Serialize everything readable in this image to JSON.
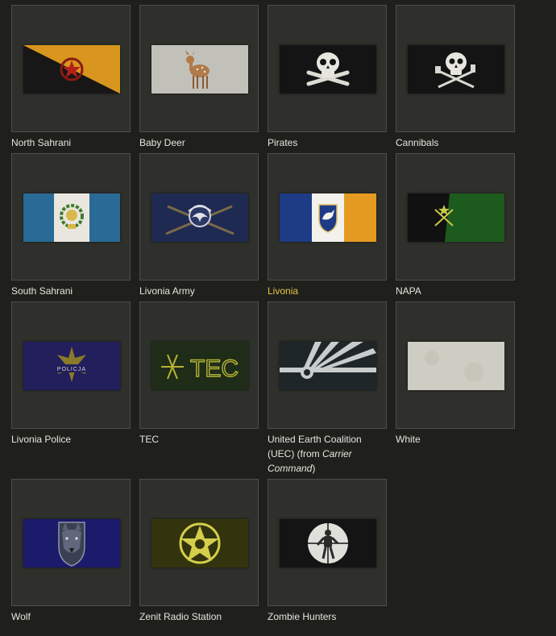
{
  "accent_color": "#e8c545",
  "flags": [
    {
      "name": "North Sahrani",
      "icon": "star-emblem-icon"
    },
    {
      "name": "Baby Deer",
      "icon": "deer-icon"
    },
    {
      "name": "Pirates",
      "icon": "skull-crossbones-icon"
    },
    {
      "name": "Cannibals",
      "icon": "skull-utensils-icon"
    },
    {
      "name": "South Sahrani",
      "icon": "wreath-emblem-icon"
    },
    {
      "name": "Livonia Army",
      "icon": "army-emblem-icon"
    },
    {
      "name": "Livonia",
      "icon": "shield-emblem-icon",
      "selected": true
    },
    {
      "name": "NAPA",
      "icon": "star-rifles-icon"
    },
    {
      "name": "Livonia Police",
      "icon": "police-badge-icon"
    },
    {
      "name": "TEC",
      "icon": "tec-logo-icon",
      "text": "TEC"
    },
    {
      "name_parts": [
        "United Earth Coalition (UEC) (from ",
        "Carrier Command",
        ")"
      ],
      "icon": "uec-emblem-icon"
    },
    {
      "name": "White",
      "icon": "blank-flag-icon"
    },
    {
      "name": "Wolf",
      "icon": "wolf-head-icon"
    },
    {
      "name": "Zenit Radio Station",
      "icon": "star-circle-icon"
    },
    {
      "name": "Zombie Hunters",
      "icon": "crosshair-zombie-icon"
    }
  ]
}
